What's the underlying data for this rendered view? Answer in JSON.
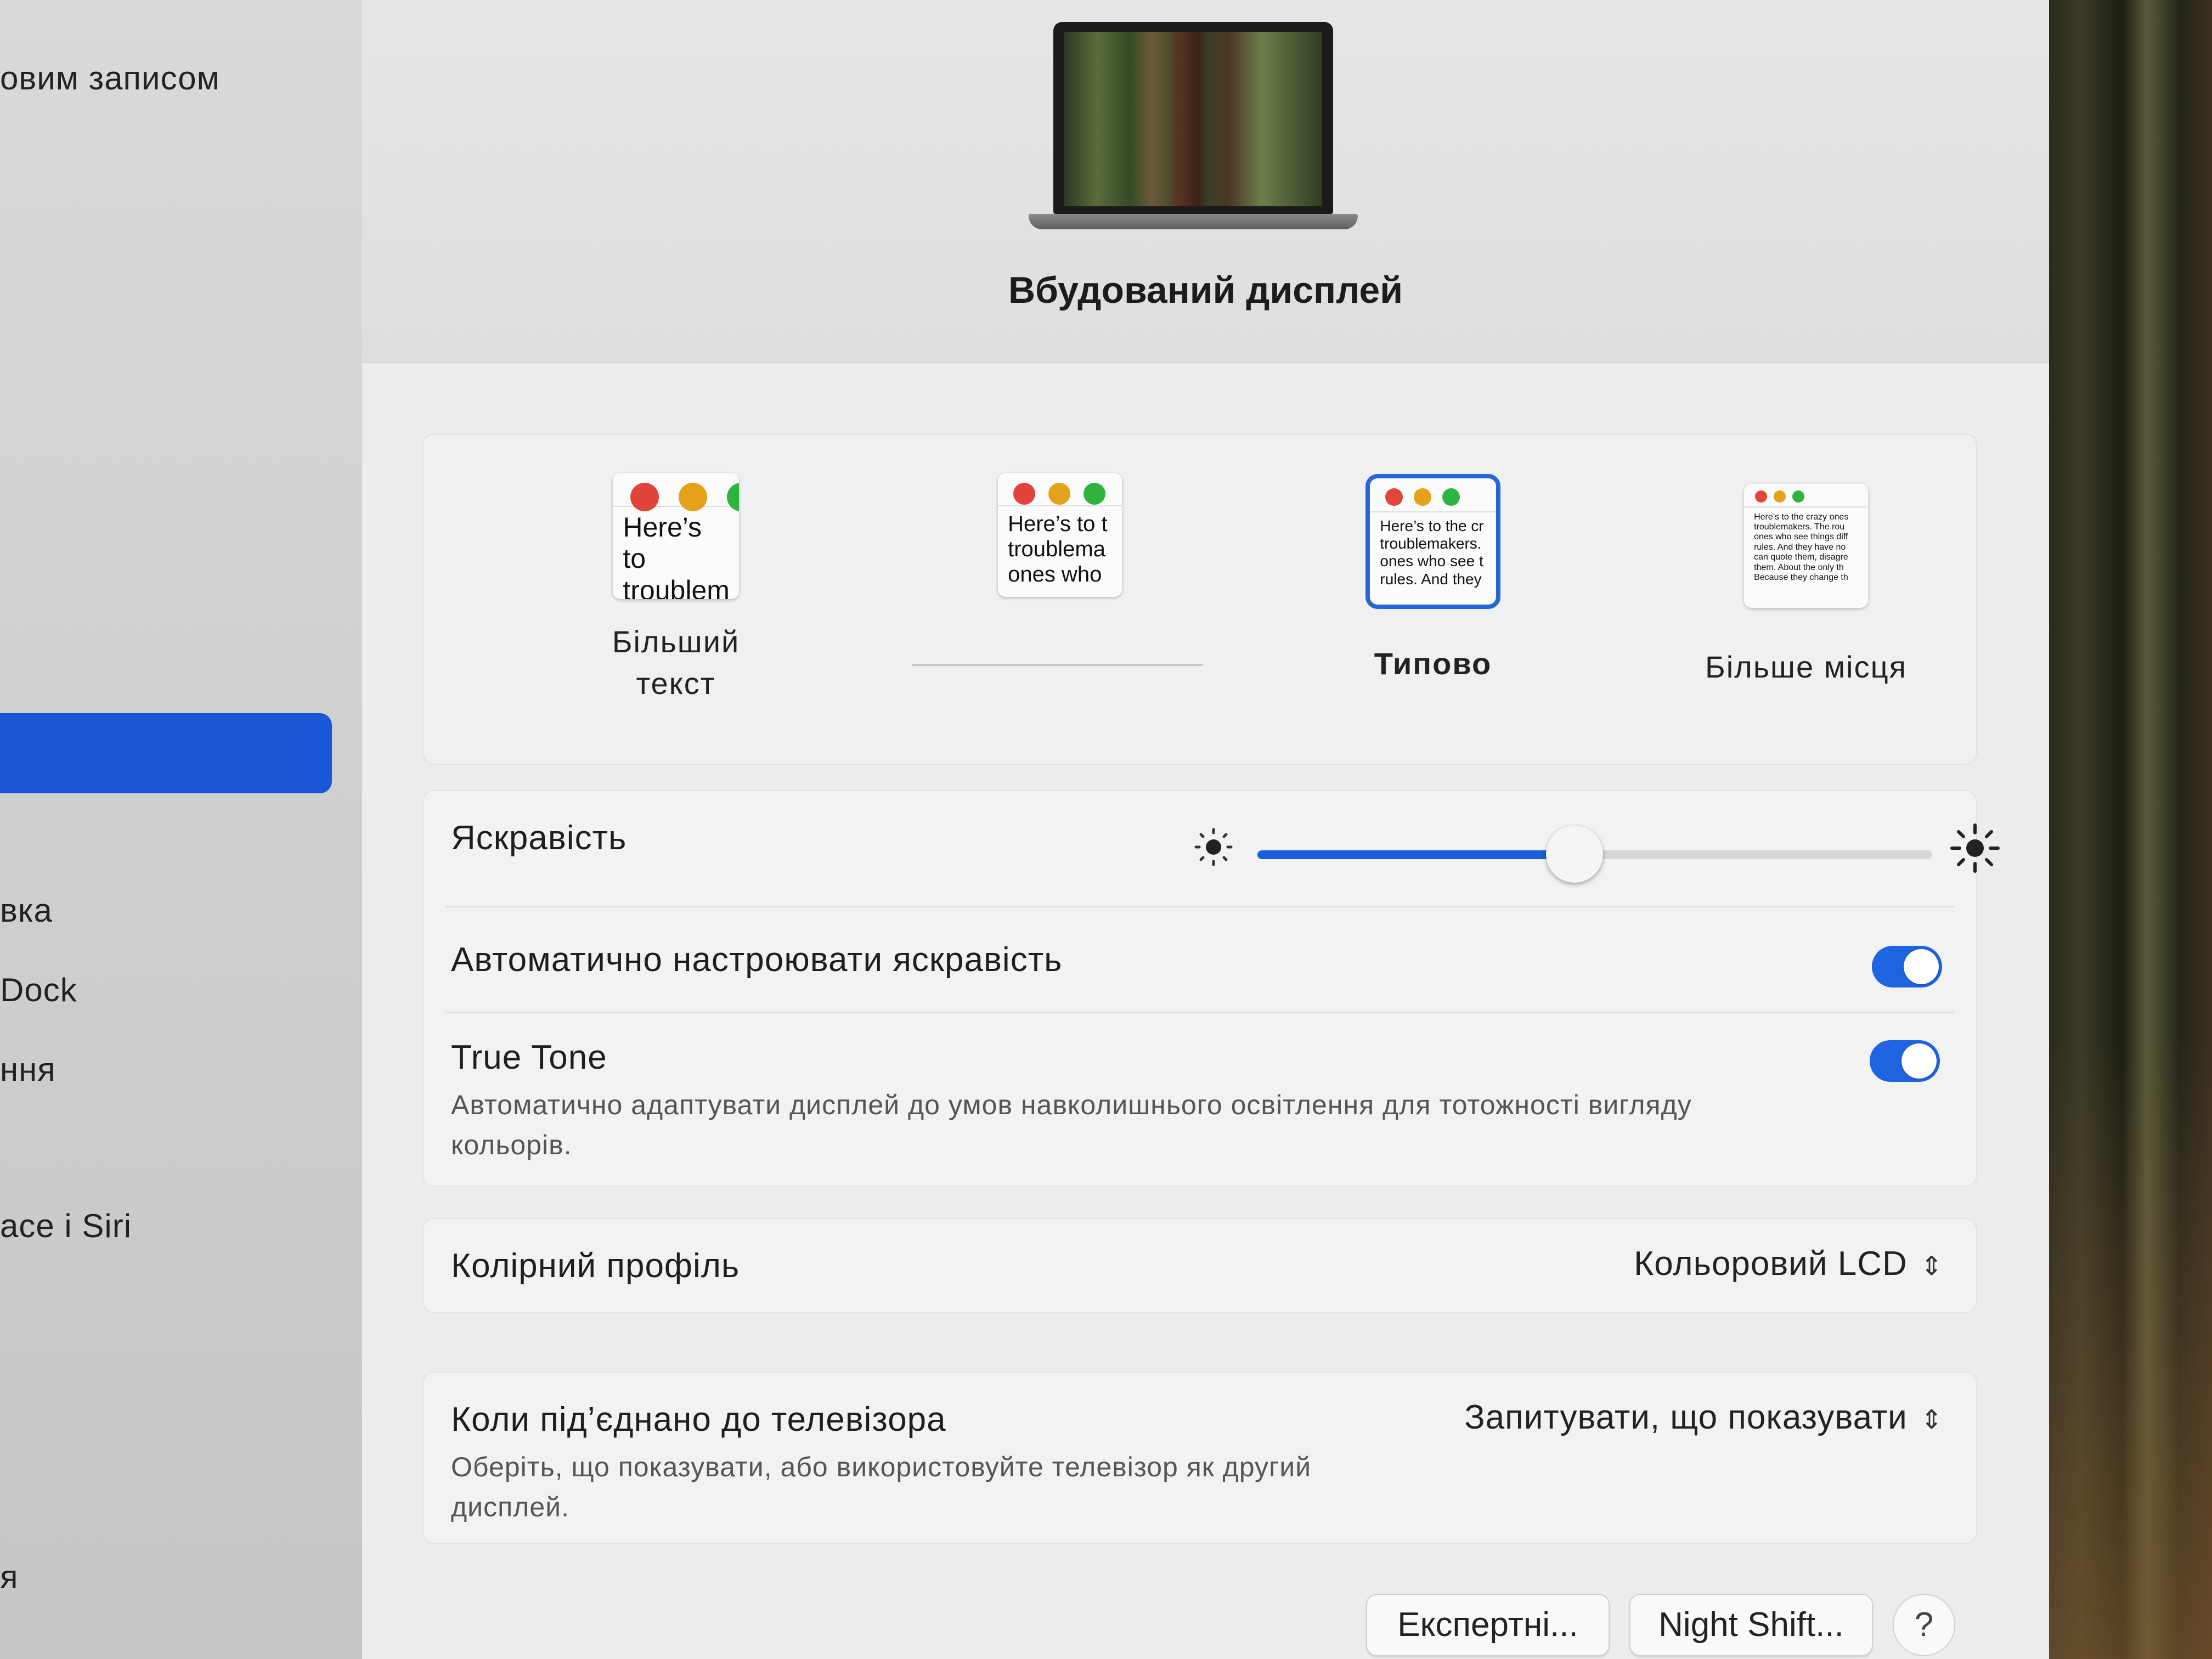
{
  "sidebar": {
    "items": [
      {
        "label": "овим записом"
      },
      {
        "label": "вка"
      },
      {
        "label": "Dock"
      },
      {
        "label": "ння"
      },
      {
        "label": "ace і Siri"
      },
      {
        "label": "я"
      }
    ]
  },
  "header": {
    "display_name": "Вбудований дисплей"
  },
  "resolution": {
    "options": [
      {
        "label": "Більший текст",
        "preview": "Here’s to\ntroublem"
      },
      {
        "label": "",
        "preview": "Here’s to t\ntroublema\nones who"
      },
      {
        "label": "Типово",
        "preview": "Here’s to the cr\ntroublemakers.\nones who see t\nrules. And they"
      },
      {
        "label": "Більше місця",
        "preview": "Here’s to the crazy ones\ntroublemakers. The rou\nones who see things diff\nrules. And they have no\ncan quote them, disagre\nthem. About the only th\nBecause they change th"
      }
    ],
    "selected_index": 2
  },
  "brightness": {
    "label": "Яскравість",
    "level": 0.47
  },
  "auto_brightness": {
    "label": "Автоматично настроювати яскравість",
    "enabled": true
  },
  "true_tone": {
    "label": "True Tone",
    "description": "Автоматично адаптувати дисплей до умов навколишнього освітлення для тотожності вигляду кольорів.",
    "enabled": true
  },
  "color_profile": {
    "label": "Колірний профіль",
    "value": "Кольоровий LCD"
  },
  "tv": {
    "label": "Коли під’єднано до телевізора",
    "description": "Оберіть, що показувати, або використовуйте телевізор як другий дисплей.",
    "value": "Запитувати, що показувати"
  },
  "buttons": {
    "advanced": "Експертні...",
    "night_shift": "Night Shift...",
    "help": "?"
  },
  "colors": {
    "accent": "#1b5fd8",
    "traffic_red": "#e0443a",
    "traffic_yellow": "#e3a21a",
    "traffic_green": "#2fb33f"
  }
}
